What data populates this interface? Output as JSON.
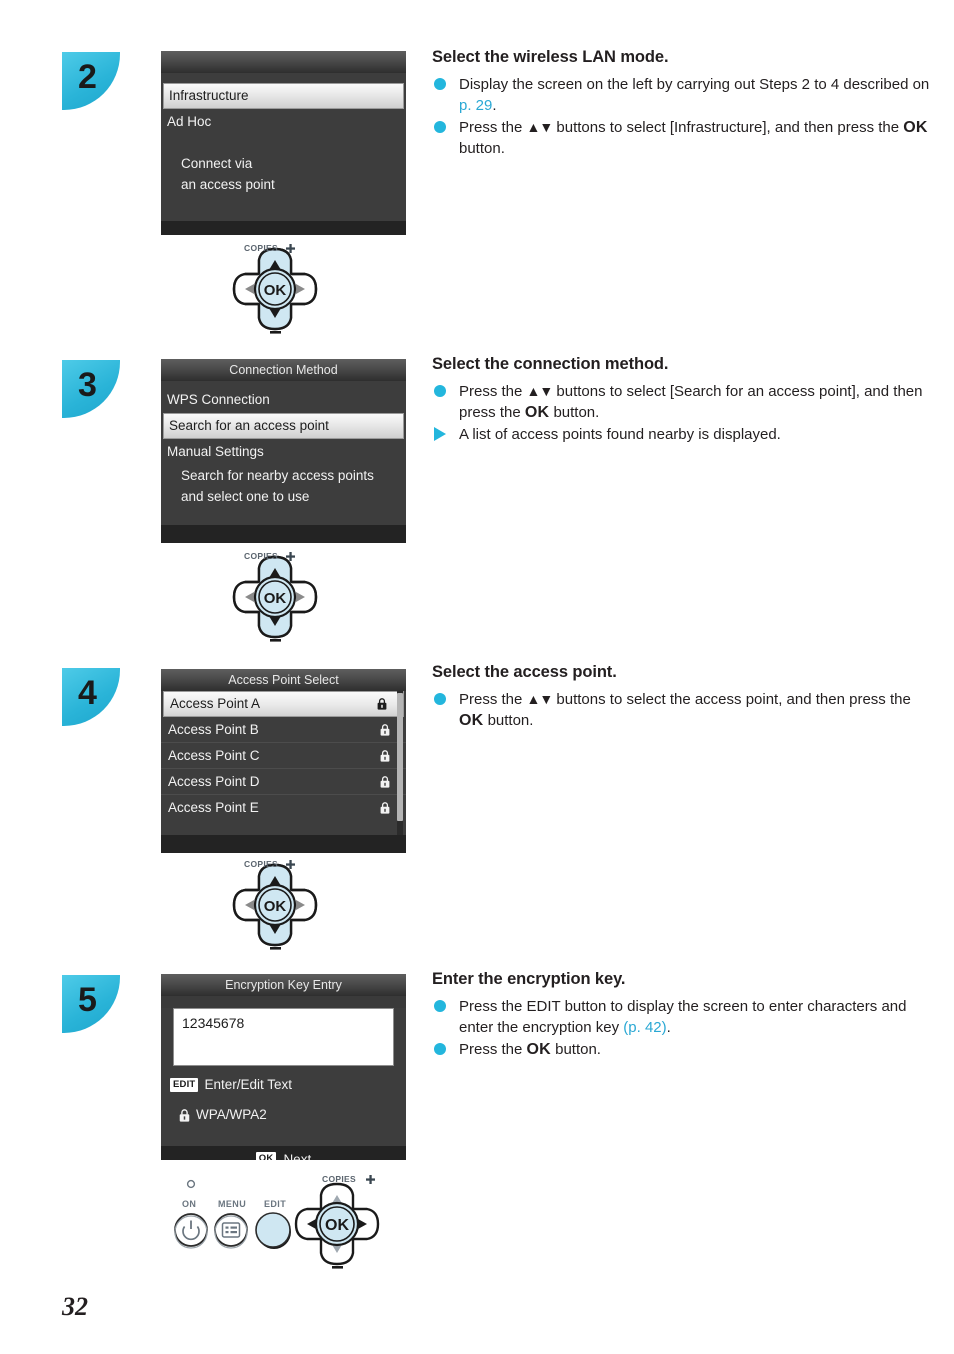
{
  "page": {
    "number": "32"
  },
  "steps": [
    {
      "badge": "2",
      "heading": "Select the wireless LAN mode.",
      "bullets": [
        {
          "sym": "dot",
          "parts": [
            {
              "t": "Display the screen on the left by carrying out Steps 2 to 4 described on "
            },
            {
              "t": "p. 29",
              "style": "ref"
            },
            {
              "t": "."
            }
          ]
        },
        {
          "sym": "dot",
          "parts": [
            {
              "t": "Press the "
            },
            {
              "t": "▲▼",
              "style": "arrows"
            },
            {
              "t": " buttons to select [Infrastructure], and then press the "
            },
            {
              "t": "OK",
              "style": "ok"
            },
            {
              "t": " button."
            }
          ]
        }
      ],
      "screen": {
        "title": "",
        "items": [
          {
            "label": "Infrastructure",
            "selected": true
          },
          {
            "label": "Ad Hoc",
            "selected": false
          }
        ],
        "notes": [
          "Connect via",
          "an access point"
        ]
      },
      "control": {
        "type": "dpad",
        "copies_label": "COPIES",
        "ok_label": "OK",
        "highlight": "vertical"
      }
    },
    {
      "badge": "3",
      "heading": "Select the connection method.",
      "bullets": [
        {
          "sym": "dot",
          "parts": [
            {
              "t": "Press the "
            },
            {
              "t": "▲▼",
              "style": "arrows"
            },
            {
              "t": " buttons to select [Search for an access point], and then press the "
            },
            {
              "t": "OK",
              "style": "ok"
            },
            {
              "t": " button."
            }
          ]
        },
        {
          "sym": "tri",
          "parts": [
            {
              "t": "A list of access points found nearby is displayed."
            }
          ]
        }
      ],
      "screen": {
        "title": "Connection Method",
        "items": [
          {
            "label": "WPS Connection",
            "selected": false
          },
          {
            "label": "Search for an access point",
            "selected": true
          },
          {
            "label": "Manual Settings",
            "selected": false
          }
        ],
        "notes": [
          "Search for nearby access points",
          "and select one to use"
        ]
      },
      "control": {
        "type": "dpad",
        "copies_label": "COPIES",
        "ok_label": "OK",
        "highlight": "vertical"
      }
    },
    {
      "badge": "4",
      "heading": "Select the access point.",
      "bullets": [
        {
          "sym": "dot",
          "parts": [
            {
              "t": "Press the "
            },
            {
              "t": "▲▼",
              "style": "arrows"
            },
            {
              "t": " buttons to select the access point, and then press the "
            },
            {
              "t": "OK",
              "style": "ok"
            },
            {
              "t": " button."
            }
          ]
        }
      ],
      "screen": {
        "title": "Access Point Select",
        "access_points": [
          {
            "label": "Access Point A",
            "locked": true,
            "selected": true
          },
          {
            "label": "Access Point B",
            "locked": true,
            "selected": false
          },
          {
            "label": "Access Point C",
            "locked": true,
            "selected": false
          },
          {
            "label": "Access Point D",
            "locked": true,
            "selected": false
          },
          {
            "label": "Access Point E",
            "locked": true,
            "selected": false
          }
        ]
      },
      "control": {
        "type": "dpad",
        "copies_label": "COPIES",
        "ok_label": "OK",
        "highlight": "vertical"
      }
    },
    {
      "badge": "5",
      "heading": "Enter the encryption key.",
      "bullets": [
        {
          "sym": "dot",
          "parts": [
            {
              "t": "Press the EDIT button to display the screen to enter characters and enter the encryption key "
            },
            {
              "t": "(p. 42)",
              "style": "ref"
            },
            {
              "t": "."
            }
          ]
        },
        {
          "sym": "dot",
          "parts": [
            {
              "t": "Press the "
            },
            {
              "t": "OK",
              "style": "ok"
            },
            {
              "t": " button."
            }
          ]
        }
      ],
      "screen": {
        "title": "Encryption Key Entry",
        "key_value": "12345678",
        "edit_badge": "EDIT",
        "edit_hint": "Enter/Edit Text",
        "security": "WPA/WPA2",
        "ok_badge": "OK",
        "footer_action": "Next"
      },
      "control": {
        "type": "button-panel",
        "buttons": [
          {
            "label": "ON",
            "icon": "power-icon"
          },
          {
            "label": "MENU",
            "icon": "menu-list-icon"
          },
          {
            "label": "EDIT",
            "icon": "none",
            "highlight": true
          }
        ],
        "copies_label": "COPIES",
        "ok_label": "OK",
        "highlight": "center"
      }
    }
  ],
  "colors": {
    "accent_cyan": "#23b6dd",
    "ref_link": "#2aa8d4",
    "badge_cyan": "#2ab4d8",
    "lcd_bg": "#3d3d3d",
    "button_highlight": "#cfe7f2"
  }
}
